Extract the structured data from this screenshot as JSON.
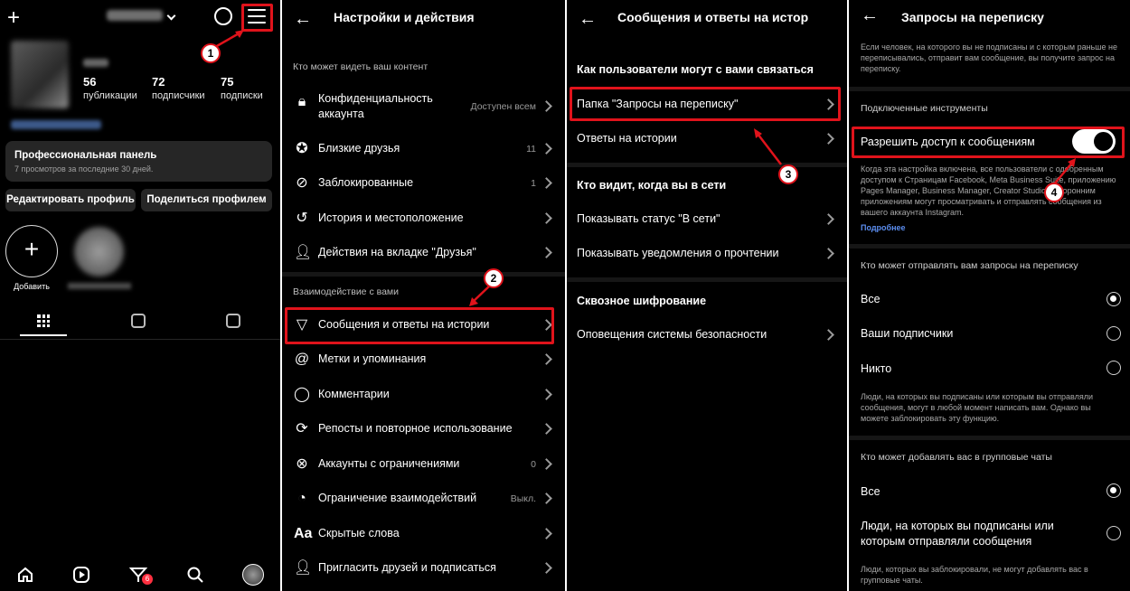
{
  "annotation_color": "#e0131b",
  "panel1": {
    "topbar": {
      "plus_icon": "plus-icon",
      "threads_icon": "threads-icon",
      "menu_icon": "hamburger-menu-icon"
    },
    "stats": [
      {
        "value": "56",
        "label": "публикации"
      },
      {
        "value": "72",
        "label": "подписчики"
      },
      {
        "value": "75",
        "label": "подписки"
      }
    ],
    "dashboard": {
      "title": "Профессиональная панель",
      "subtitle": "7 просмотров за последние 30 дней."
    },
    "buttons": {
      "edit": "Редактировать профиль",
      "share": "Поделиться профилем"
    },
    "highlights": {
      "add_label": "Добавить"
    },
    "badge_count": "6",
    "annotation": "1"
  },
  "panel2": {
    "title": "Настройки и действия",
    "section1": "Кто может видеть ваш контент",
    "section2": "Взаимодействие с вами",
    "items1": [
      {
        "label": "Конфиденциальность",
        "label2": "аккаунта",
        "value": "Доступен всем"
      },
      {
        "label": "Близкие друзья",
        "value": "11"
      },
      {
        "label": "Заблокированные",
        "value": "1"
      },
      {
        "label": "История и местоположение",
        "value": ""
      },
      {
        "label": "Действия на вкладке \"Друзья\"",
        "value": ""
      }
    ],
    "items2": [
      {
        "label": "Сообщения и ответы на истории",
        "value": ""
      },
      {
        "label": "Метки и упоминания",
        "value": ""
      },
      {
        "label": "Комментарии",
        "value": ""
      },
      {
        "label": "Репосты и повторное использование",
        "value": ""
      },
      {
        "label": "Аккаунты с ограничениями",
        "value": "0"
      },
      {
        "label": "Ограничение взаимодействий",
        "value": "Выкл."
      },
      {
        "label": "Скрытые слова",
        "value": ""
      },
      {
        "label": "Пригласить друзей и подписаться",
        "value": ""
      }
    ],
    "annotation": "2"
  },
  "panel3": {
    "title": "Сообщения и ответы на истор",
    "h1": "Как пользователи могут с вами связаться",
    "r1": "Папка \"Запросы на переписку\"",
    "r2": "Ответы на истории",
    "h2": "Кто видит, когда вы в сети",
    "r3": "Показывать статус \"В сети\"",
    "r4": "Показывать уведомления о прочтении",
    "h3": "Сквозное шифрование",
    "r5": "Оповещения системы безопасности",
    "annotation": "3"
  },
  "panel4": {
    "title": "Запросы на переписку",
    "intro": "Если человек, на которого вы не подписаны и с которым раньше не переписывались, отправит вам сообщение, вы получите запрос на переписку.",
    "section_tools": "Подключенные инструменты",
    "toggle_label": "Разрешить доступ к сообщениям",
    "toggle_on": true,
    "toggle_desc": "Когда эта настройка включена, все пользователи с одобренным доступом к Страницам Facebook, Meta Business Suite, приложению Pages Manager, Business Manager, Creator Studio и сторонним приложениям могут просматривать и отправлять сообщения из вашего аккаунта Instagram.",
    "more_link": "Подробнее",
    "section_requests": "Кто может отправлять вам запросы на переписку",
    "opt_all": "Все",
    "opt_followers": "Ваши подписчики",
    "opt_none": "Никто",
    "requests_note": "Люди, на которых вы подписаны или которым вы отправляли сообщения, могут в любой момент написать вам. Однако вы можете заблокировать эту функцию.",
    "section_groups": "Кто может добавлять вас в групповые чаты",
    "grp_all": "Все",
    "grp_people_1": "Люди, на которых вы подписаны или",
    "grp_people_2": "которым отправляли сообщения",
    "groups_note": "Люди, которых вы заблокировали, не могут добавлять вас в групповые чаты.",
    "annotation": "4"
  }
}
